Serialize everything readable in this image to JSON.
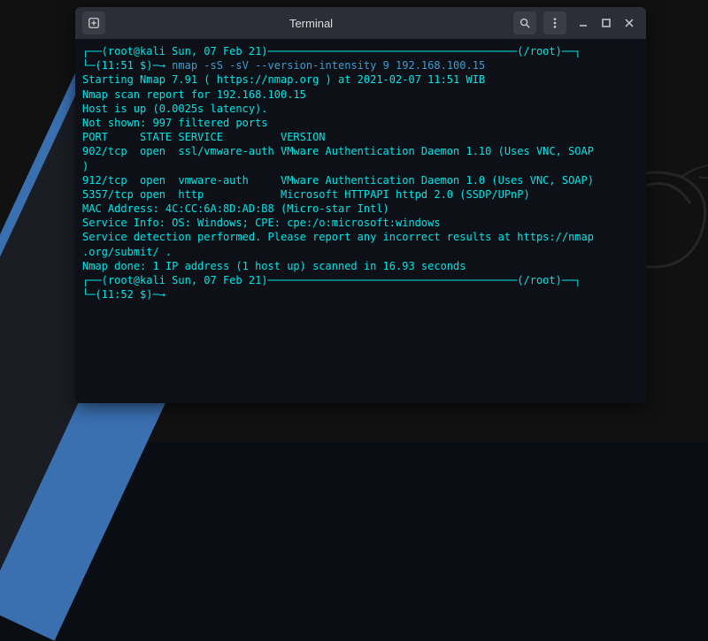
{
  "window": {
    "title": "Terminal"
  },
  "prompt1": {
    "line1": "┌──(root@kali Sun, 07 Feb 21)───────────────────────────────────────(/root)──┐",
    "line2_prefix": "└─(11:51 $)─→ ",
    "command": "nmap -sS -sV --version-intensity 9 192.168.100.15"
  },
  "output": {
    "l1": "Starting Nmap 7.91 ( https://nmap.org ) at 2021-02-07 11:51 WIB",
    "l2": "Nmap scan report for 192.168.100.15",
    "l3": "Host is up (0.0025s latency).",
    "l4": "Not shown: 997 filtered ports",
    "l5": "PORT     STATE SERVICE         VERSION",
    "l6": "902/tcp  open  ssl/vmware-auth VMware Authentication Daemon 1.10 (Uses VNC, SOAP",
    "l6b": ")",
    "l7": "912/tcp  open  vmware-auth     VMware Authentication Daemon 1.0 (Uses VNC, SOAP)",
    "l8": "5357/tcp open  http            Microsoft HTTPAPI httpd 2.0 (SSDP/UPnP)",
    "l9": "MAC Address: 4C:CC:6A:8D:AD:B8 (Micro-star Intl)",
    "l10": "Service Info: OS: Windows; CPE: cpe:/o:microsoft:windows",
    "l11": "",
    "l12": "Service detection performed. Please report any incorrect results at https://nmap",
    "l12b": ".org/submit/ .",
    "l13": "Nmap done: 1 IP address (1 host up) scanned in 16.93 seconds"
  },
  "prompt2": {
    "line1": "┌──(root@kali Sun, 07 Feb 21)───────────────────────────────────────(/root)──┐",
    "line2_prefix": "└─(11:52 $)─→ "
  }
}
